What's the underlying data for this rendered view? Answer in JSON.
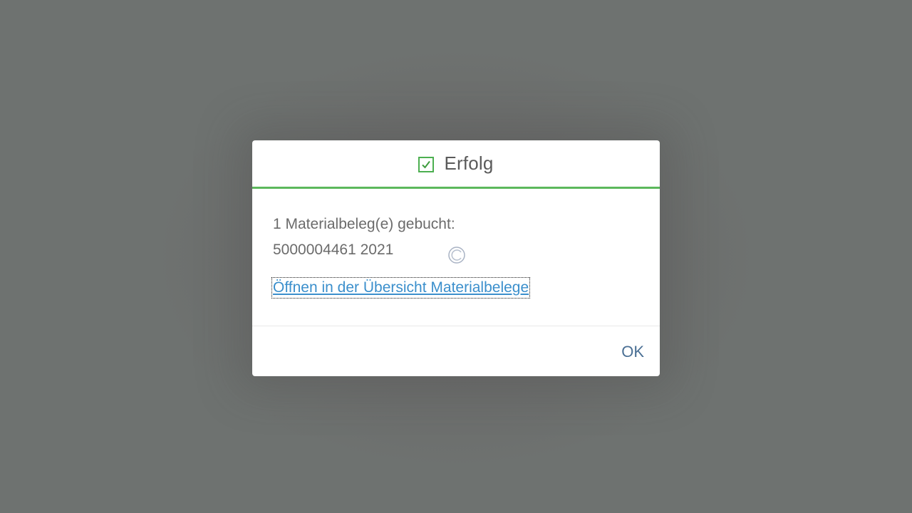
{
  "dialog": {
    "title": "Erfolg",
    "title_icon": "success-checkbox-icon",
    "message_line1": "1 Materialbeleg(e) gebucht:",
    "message_line2": "5000004461 2021",
    "link_text": "Öffnen in der Übersicht Materialbelege",
    "ok_label": "OK",
    "busy_icon": "loading-indicator-icon"
  },
  "colors": {
    "success": "#5cb85c",
    "link": "#3b8fcc",
    "button": "#4a6f94",
    "overlay": "#6e7270"
  }
}
